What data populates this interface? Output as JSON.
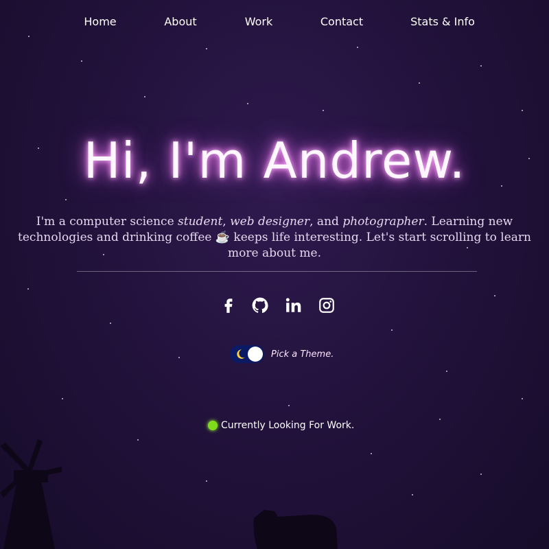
{
  "nav": {
    "items": [
      {
        "label": "Home"
      },
      {
        "label": "About"
      },
      {
        "label": "Work"
      },
      {
        "label": "Contact"
      },
      {
        "label": "Stats & Info"
      }
    ]
  },
  "hero": {
    "title": "Hi, I'm Andrew."
  },
  "intro": {
    "part1": "I'm a computer science ",
    "student": "student",
    "comma1": ", ",
    "web_designer": "web designer",
    "and": ", and ",
    "photographer": "photographer",
    "part2": ". Learning new",
    "part3": "technologies and drinking coffee ",
    "coffee": "☕",
    "part4": " keeps life interesting. Let's start scrolling to learn",
    "part5": "more about me."
  },
  "social": {
    "icons": [
      "facebook-icon",
      "github-icon",
      "linkedin-icon",
      "instagram-icon"
    ]
  },
  "theme": {
    "label": "Pick a Theme.",
    "toggle_icon": "moon-icon"
  },
  "status": {
    "text": "Currently Looking For Work.",
    "dot_color": "#7fdc1b"
  },
  "colors": {
    "background": "#22123c",
    "title_glow": "#ff78f0",
    "toggle_bg": "#0b1a64"
  }
}
